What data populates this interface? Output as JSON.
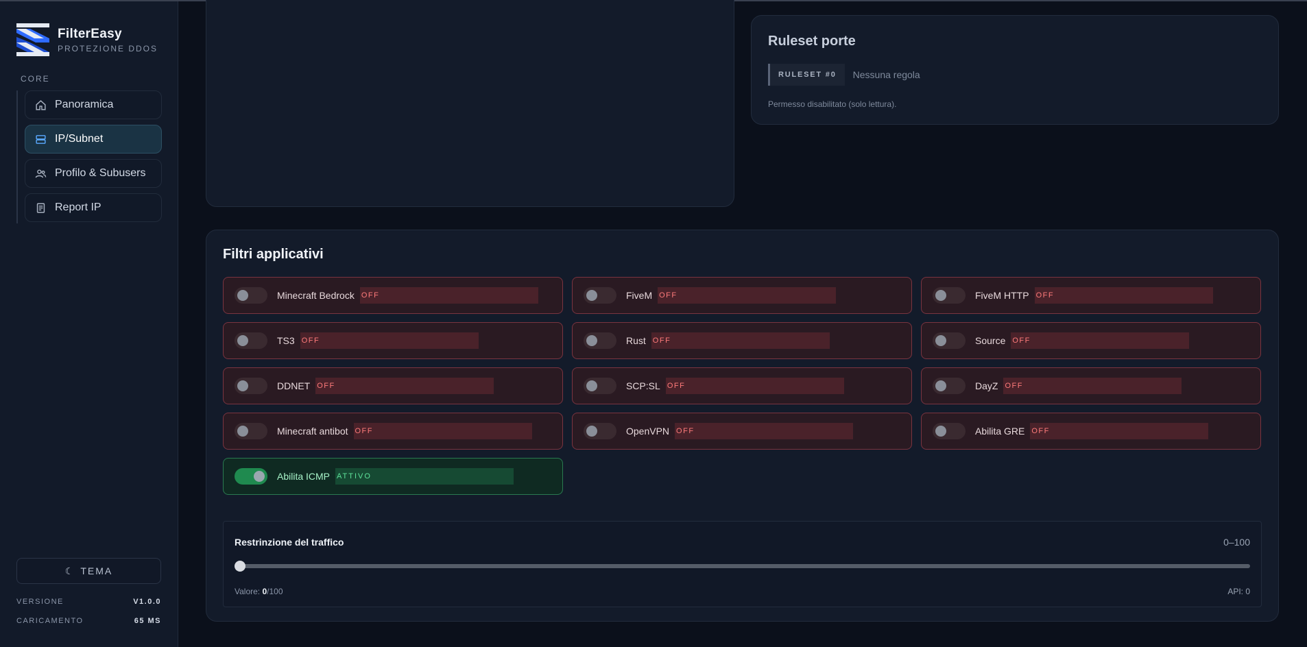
{
  "brand": {
    "name": "FilterEasy",
    "subtitle": "PROTEZIONE DDOS"
  },
  "sidebar": {
    "section": "CORE",
    "items": [
      {
        "label": "Panoramica",
        "icon": "home-icon",
        "active": false
      },
      {
        "label": "IP/Subnet",
        "icon": "server-icon",
        "active": true
      },
      {
        "label": "Profilo & Subusers",
        "icon": "users-icon",
        "active": false
      },
      {
        "label": "Report IP",
        "icon": "document-icon",
        "active": false
      }
    ],
    "theme_label": "TEMA",
    "theme_icon": "☾",
    "version_label": "VERSIONE",
    "version_value": "V1.0.0",
    "loading_label": "CARICAMENTO",
    "loading_value": "65 MS"
  },
  "ruleset": {
    "title": "Ruleset porte",
    "tag": "RULESET #0",
    "value": "Nessuna regola",
    "note": "Permesso disabilitato (solo lettura)."
  },
  "filters": {
    "title": "Filtri applicativi",
    "items": [
      {
        "label": "Minecraft Bedrock",
        "status": "OFF",
        "enabled": false
      },
      {
        "label": "FiveM",
        "status": "OFF",
        "enabled": false
      },
      {
        "label": "FiveM HTTP",
        "status": "OFF",
        "enabled": false
      },
      {
        "label": "TS3",
        "status": "OFF",
        "enabled": false
      },
      {
        "label": "Rust",
        "status": "OFF",
        "enabled": false
      },
      {
        "label": "Source",
        "status": "OFF",
        "enabled": false
      },
      {
        "label": "DDNET",
        "status": "OFF",
        "enabled": false
      },
      {
        "label": "SCP:SL",
        "status": "OFF",
        "enabled": false
      },
      {
        "label": "DayZ",
        "status": "OFF",
        "enabled": false
      },
      {
        "label": "Minecraft antibot",
        "status": "OFF",
        "enabled": false
      },
      {
        "label": "OpenVPN",
        "status": "OFF",
        "enabled": false
      },
      {
        "label": "Abilita GRE",
        "status": "OFF",
        "enabled": false
      },
      {
        "label": "Abilita ICMP",
        "status": "ATTIVO",
        "enabled": true
      }
    ]
  },
  "traffic": {
    "title": "Restrinzione del traffico",
    "range": "0–100",
    "value_label": "Valore:",
    "value": "0",
    "max": "/100",
    "api": "API: 0",
    "level": 0
  },
  "colors": {
    "accent": "#1a3344",
    "off_border": "#7a3440",
    "on_border": "#2a7a50",
    "off_text": "#ff7b7b",
    "on_text": "#5ee29a"
  }
}
